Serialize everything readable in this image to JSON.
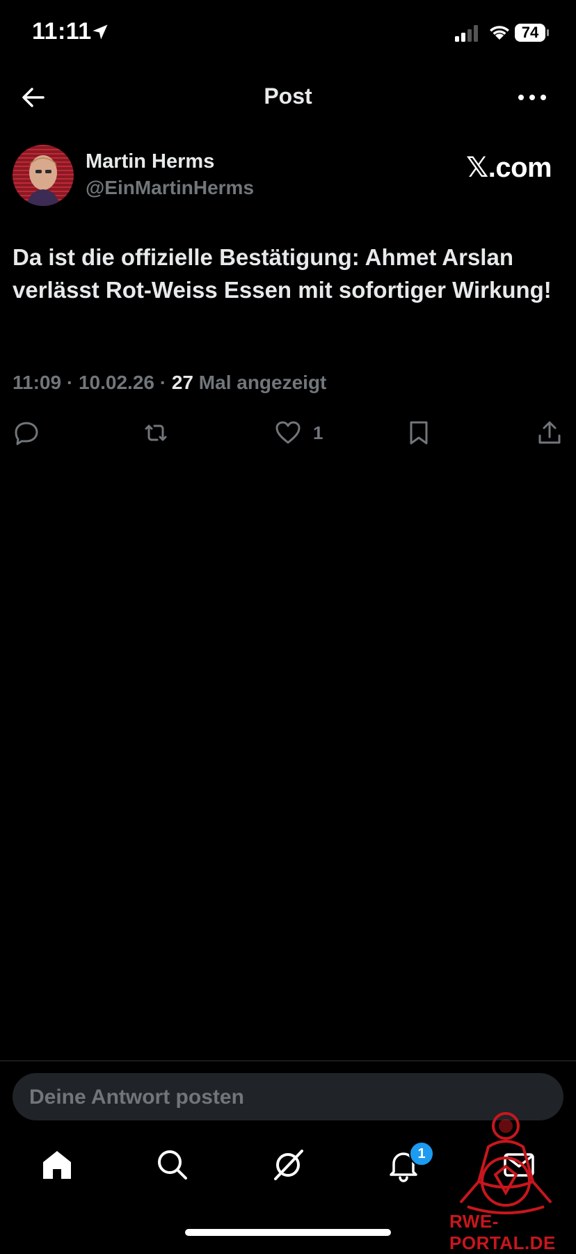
{
  "status_bar": {
    "time": "11:11",
    "battery": "74"
  },
  "header": {
    "title": "Post"
  },
  "author": {
    "name": "Martin Herms",
    "handle": "@EinMartinHerms"
  },
  "branding": {
    "xcom": "𝕏.com"
  },
  "post": {
    "text": "Da ist die offizielle Bestätigung: Ahmet Arslan verlässt Rot-Weiss Essen mit sofortiger Wirkung!",
    "time": "11:09",
    "date": "10.02.26",
    "views_count": "27",
    "views_label": "Mal angezeigt"
  },
  "actions": {
    "like_count": "1"
  },
  "reply": {
    "placeholder": "Deine Antwort posten"
  },
  "nav": {
    "notifications_badge": "1"
  },
  "watermark": {
    "text": "RWE-PORTAL.DE"
  },
  "colors": {
    "accent": "#1d9bf0",
    "muted": "#71767b",
    "text": "#e7e9ea",
    "watermark": "#c8161d"
  }
}
